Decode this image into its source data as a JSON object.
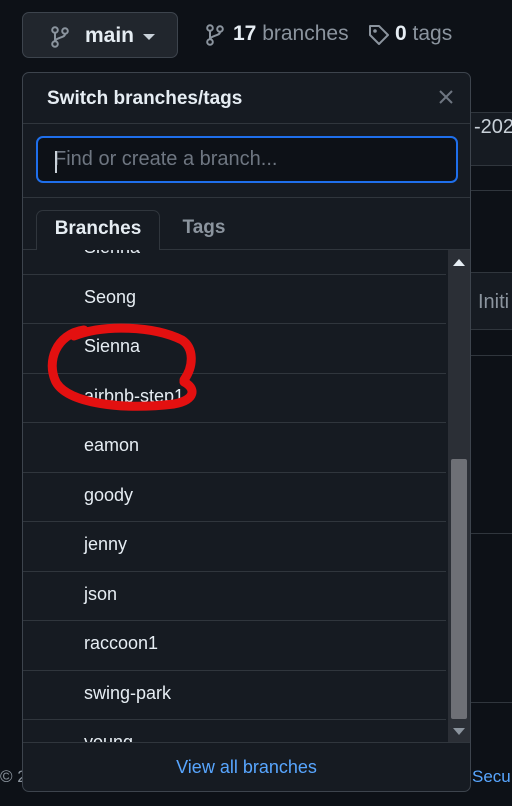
{
  "header": {
    "branch_button_label": "main",
    "branches_count": "17",
    "branches_label": "branches",
    "tags_count": "0",
    "tags_label": "tags"
  },
  "background": {
    "date_fragment": "-202",
    "commit_fragment": "Initi",
    "footer_left": "© 2",
    "footer_right": "Secu"
  },
  "dropdown": {
    "title": "Switch branches/tags",
    "search_placeholder": "Find or create a branch...",
    "tabs": [
      {
        "label": "Branches",
        "active": true
      },
      {
        "label": "Tags",
        "active": false
      }
    ],
    "branches": [
      {
        "label": "Sienna"
      },
      {
        "label": "Seong"
      },
      {
        "label": "Sienna"
      },
      {
        "label": "airbnb-step1"
      },
      {
        "label": "eamon"
      },
      {
        "label": "goody"
      },
      {
        "label": "jenny"
      },
      {
        "label": "json"
      },
      {
        "label": "raccoon1"
      },
      {
        "label": "swing-park"
      },
      {
        "label": "young"
      }
    ],
    "footer_link": "View all branches"
  },
  "colors": {
    "background": "#0d1117",
    "panel": "#161b22",
    "accent_link": "#58a6ff",
    "focus_border": "#1f6feb",
    "annotation": "#e31010"
  },
  "icons": [
    "git-branch-icon",
    "tag-icon",
    "close-icon",
    "caret-down-icon"
  ]
}
